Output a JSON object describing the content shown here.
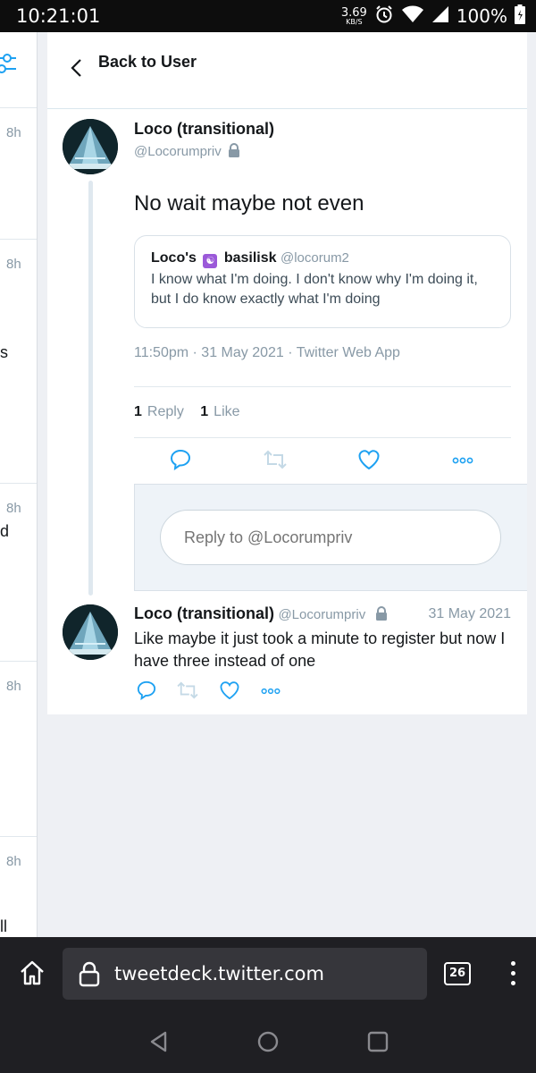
{
  "status_bar": {
    "time": "10:21:01",
    "net_speed_value": "3.69",
    "net_speed_unit": "KB/S",
    "battery": "100%"
  },
  "left_column": {
    "times": [
      "8h",
      "8h",
      "8h",
      "8h",
      "8h"
    ],
    "fragments": [
      "s",
      "d",
      "ll"
    ]
  },
  "header": {
    "back_label": "Back to User"
  },
  "main_tweet": {
    "name": "Loco (transitional)",
    "handle": "@Locorumpriv",
    "text": "No wait maybe not even",
    "quote": {
      "name_prefix": "Loco's",
      "name_emoji": "☯",
      "name_suffix": "basilisk",
      "handle": "@locorum2",
      "text": "I know what I'm doing. I don't know why I'm doing it, but I do know exactly what I'm doing"
    },
    "meta": "11:50pm · 31 May 2021 · Twitter Web App",
    "stats": {
      "reply_count": "1",
      "reply_label": "Reply",
      "like_count": "1",
      "like_label": "Like"
    },
    "actions": [
      "reply-icon",
      "retweet-icon",
      "like-icon",
      "more-icon"
    ]
  },
  "reply_box": {
    "placeholder": "Reply to @Locorumpriv"
  },
  "reply_tweet": {
    "name": "Loco (transitional)",
    "handle": "@Locorumpriv",
    "date": "31 May 2021",
    "text": "Like maybe it just took a minute to register but now I have three instead of one"
  },
  "browser": {
    "url": "tweetdeck.twitter.com",
    "tab_count": "26"
  },
  "colors": {
    "accent": "#1da1f2",
    "text_primary": "#14171a",
    "text_secondary": "#8899a6",
    "quote_emoji_bg": "#9b59d9"
  }
}
